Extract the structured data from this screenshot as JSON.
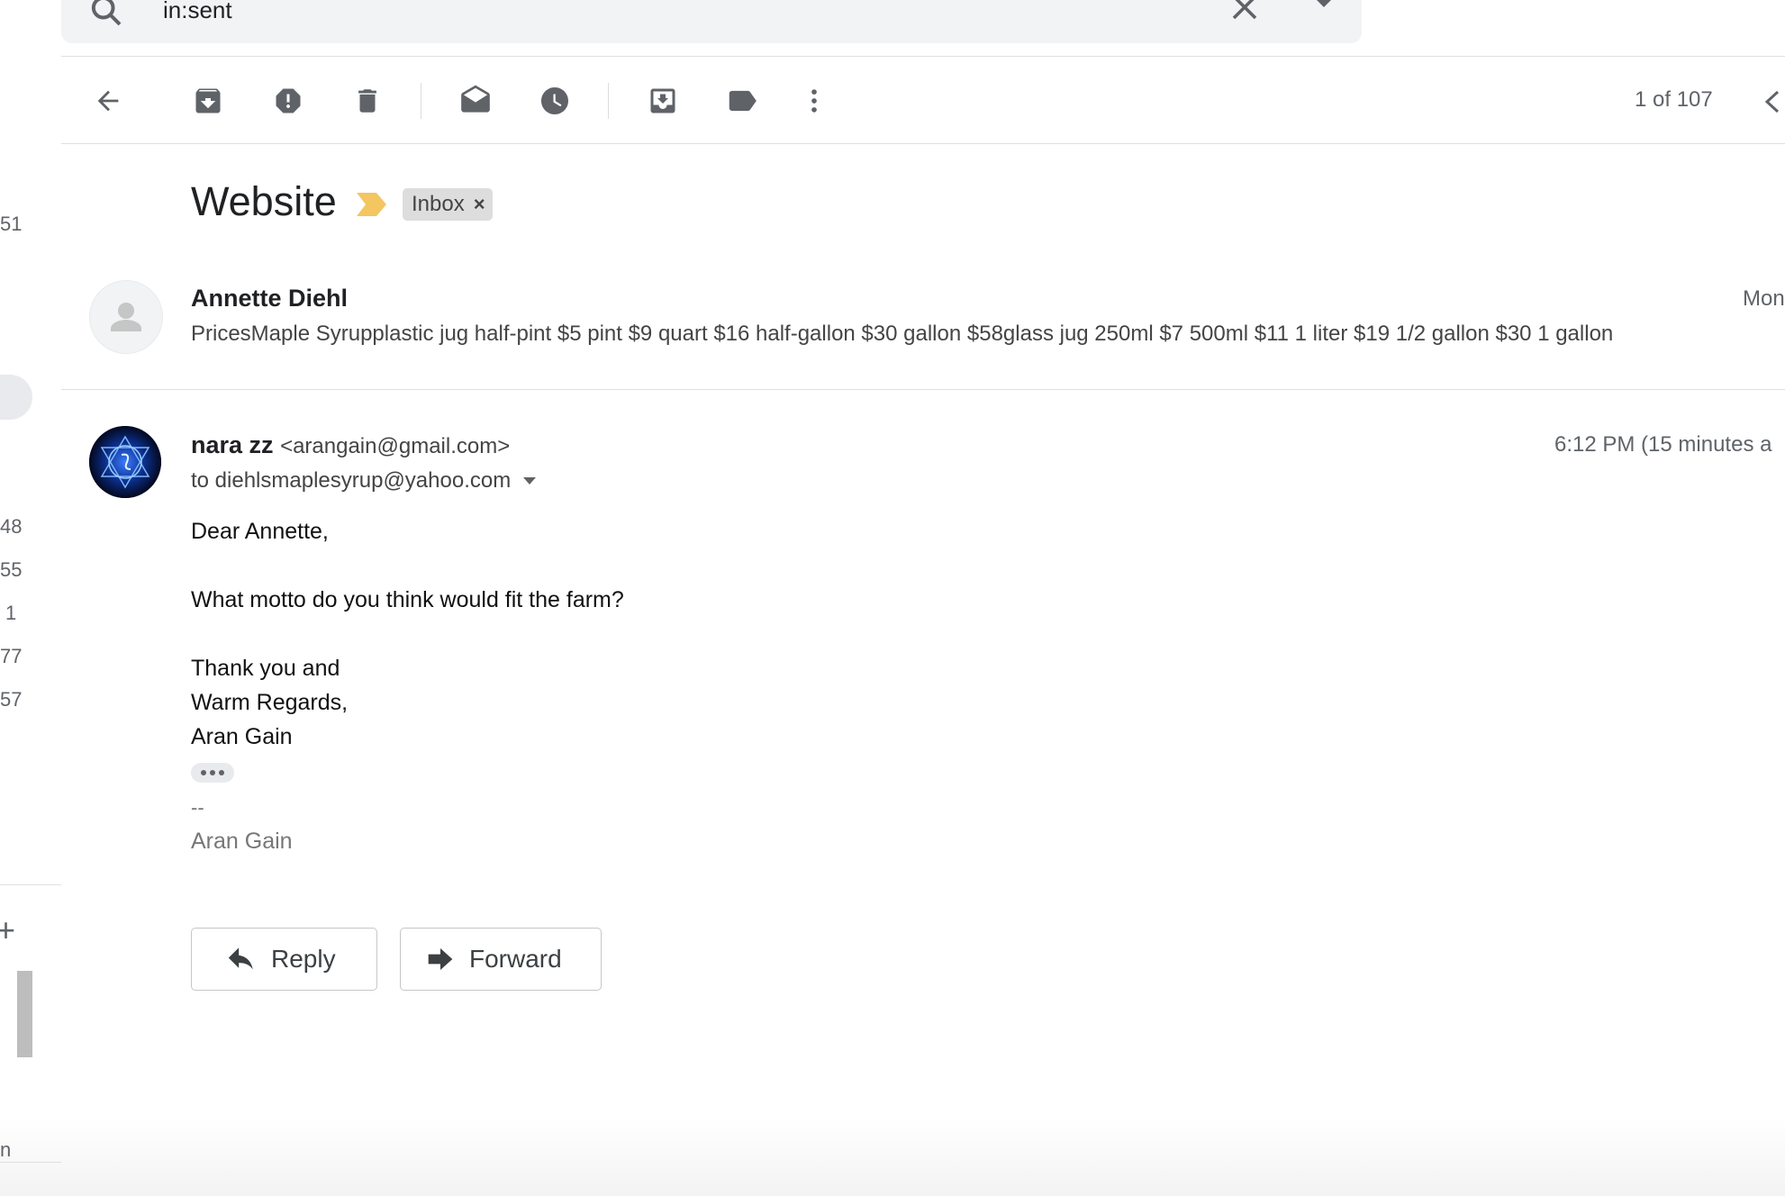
{
  "search": {
    "query": "in:sent"
  },
  "toolbar": {
    "icons": [
      "back-arrow-icon",
      "archive-icon",
      "report-spam-icon",
      "delete-icon",
      "mark-unread-icon",
      "snooze-icon",
      "move-to-icon",
      "labels-icon",
      "more-icon"
    ],
    "pager": "1 of 107"
  },
  "left_strip": {
    "counts": [
      "51",
      "48",
      "55",
      "1",
      "77",
      "57"
    ],
    "bottom_text": "n"
  },
  "thread": {
    "subject": "Website",
    "label_chip": "Inbox",
    "label_chip_close": "×",
    "important_marker_color": "#f4c662"
  },
  "messages": [
    {
      "sender": "Annette Diehl",
      "date": "Mon",
      "snippet": "PricesMaple Syrupplastic jug half-pint $5 pint $9 quart $16 half-gallon $30 gallon $58glass jug 250ml $7 500ml $11 1 liter $19 1/2 gallon $30 1 gallon"
    },
    {
      "sender_name": "nara zz",
      "sender_email": "<arangain@gmail.com>",
      "date": "6:12 PM (15 minutes a",
      "to": "to diehlsmaplesyrup@yahoo.com",
      "body": [
        "Dear Annette,",
        "What motto do you think would fit the farm?",
        "Thank you and",
        "Warm Regards,",
        "Aran Gain"
      ],
      "signature_dash": "--",
      "signature_name": "Aran Gain"
    }
  ],
  "actions": {
    "reply": "Reply",
    "forward": "Forward"
  },
  "colors": {
    "accent_icon": "#5f6368",
    "chip_bg": "#dddddd"
  }
}
